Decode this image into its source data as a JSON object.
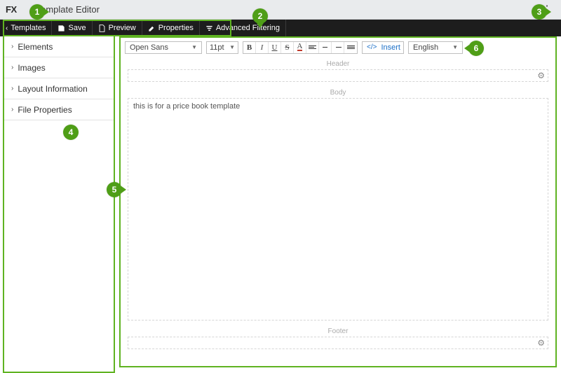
{
  "titlebar": {
    "logo": "FX",
    "title": "Template Editor"
  },
  "menu": {
    "templates": "Templates",
    "save": "Save",
    "preview": "Preview",
    "properties": "Properties",
    "advanced_filtering": "Advanced Filtering"
  },
  "sidebar": {
    "items": [
      {
        "label": "Elements"
      },
      {
        "label": "Images"
      },
      {
        "label": "Layout Information"
      },
      {
        "label": "File Properties"
      }
    ]
  },
  "toolbar": {
    "font": "Open Sans",
    "size": "11pt",
    "insert": "Insert",
    "lang": "English"
  },
  "page": {
    "header_label": "Header",
    "body_label": "Body",
    "footer_label": "Footer",
    "body_text": "this is for a price book template"
  },
  "callouts": {
    "c1": "1",
    "c2": "2",
    "c3": "3",
    "c4": "4",
    "c5": "5",
    "c6": "6"
  }
}
